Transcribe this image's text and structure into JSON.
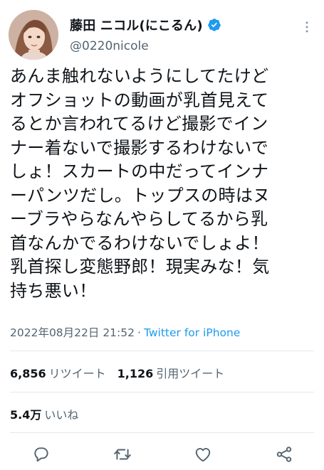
{
  "user": {
    "display_name": "藤田 ニコル(にこるん)",
    "handle": "@0220nicole",
    "verified": true
  },
  "tweet": {
    "text": "あんま触れないようにしてたけど\nオフショットの動画が乳首見えて\nるとか言われてるけど撮影でイン\nナー着ないで撮影するわけないで\nしょ！スカートの中だってインナ\nーパンツだし。トップスの時はヌ\nーブラやらなんやらしてるから乳\n首なんかでるわけないでしょよ！\n乳首探し変態野郎！現実みな！気\n持ち悪い！",
    "timestamp": "2022年08月22日 21:52",
    "separator": "·",
    "source": "Twitter for iPhone"
  },
  "stats": {
    "retweets_count": "6,856",
    "retweets_label": "リツイート",
    "quotes_count": "1,126",
    "quotes_label": "引用ツイート",
    "likes_count": "5.4万",
    "likes_label": "いいね"
  },
  "actions": [
    "reply-icon",
    "retweet-icon",
    "like-icon",
    "share-icon"
  ],
  "colors": {
    "text": "#0f1419",
    "muted": "#536471",
    "accent": "#1d9bf0",
    "divider": "#e4e8eb"
  }
}
